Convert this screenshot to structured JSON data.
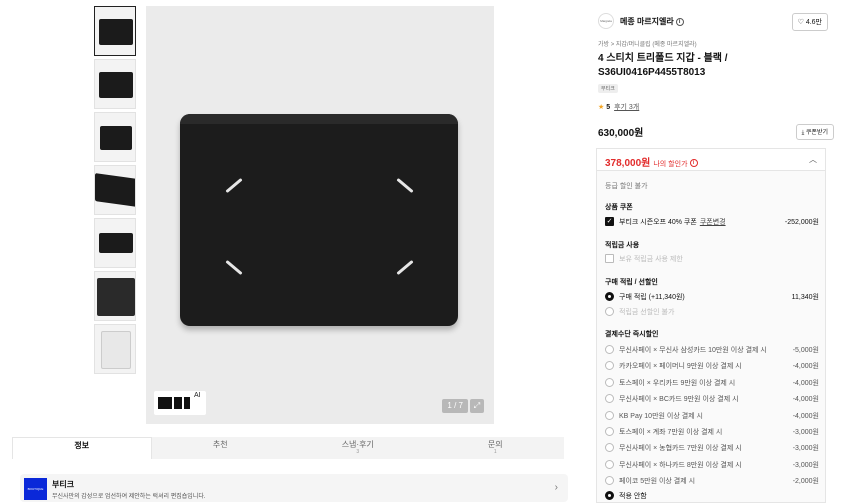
{
  "thumbnails": [
    "thumb-1",
    "thumb-2",
    "thumb-3",
    "thumb-4",
    "thumb-5",
    "thumb-6",
    "thumb-7"
  ],
  "image": {
    "ai_badge": "AI",
    "counter": "1 / 7"
  },
  "tabs": [
    {
      "label": "정보",
      "sub": ""
    },
    {
      "label": "추천",
      "sub": ""
    },
    {
      "label": "스냅·후기",
      "sub": "3"
    },
    {
      "label": "문의",
      "sub": "1"
    }
  ],
  "shop": {
    "logo_text": "BOUTIQUE",
    "name": "부티크",
    "desc": "무신사만의 감성으로 엄선하여 제안하는 럭셔리 편집숍입니다."
  },
  "product": {
    "brand": "메종 마르지엘라",
    "brand_logo_text": "Margiela",
    "likes": "4.6만",
    "breadcrumb": "가방 > 지갑/머니클립 (메종 마르지엘라)",
    "title": "4 스티치 트리폴드 지갑 - 블랙 / S36UI0416P4455T8013",
    "tag": "부티크",
    "rating": "5",
    "review_link": "후기 3개",
    "price": "630,000원",
    "coupon_button": "쿠폰받기"
  },
  "benefit": {
    "my_price": "378,000원",
    "my_price_label": "나의 할인가",
    "grade_text": "등급 할인 불가",
    "coupon_title": "상품 쿠폰",
    "coupon_label": "부티크 시즌오프 40% 쿠폰",
    "coupon_change": "쿠폰변경",
    "coupon_amount": "-252,000원",
    "points_title": "적립금 사용",
    "points_option": "보유 적립금 사용 제한",
    "purchase_title": "구매 적립 / 선할인",
    "purchase_option": "구매 적립 (+11,340원)",
    "purchase_amount": "11,340원",
    "prediscount_option": "적립금 선할인 불가",
    "payment_title": "결제수단 즉시할인",
    "payment_options": [
      {
        "label": "무신사페이 × 무신사 삼성카드 10만원 이상 결제 시",
        "amount": "-5,000원"
      },
      {
        "label": "카카오페이 × 페이머니 9만원 이상 결제 시",
        "amount": "-4,000원"
      },
      {
        "label": "토스페이 × 우리카드 9만원 이상 결제 시",
        "amount": "-4,000원"
      },
      {
        "label": "무신사페이 × BC카드 9만원 이상 결제 시",
        "amount": "-4,000원"
      },
      {
        "label": "KB Pay 10만원 이상 결제 시",
        "amount": "-4,000원"
      },
      {
        "label": "토스페이 × 계좌 7만원 이상 결제 시",
        "amount": "-3,000원"
      },
      {
        "label": "무신사페이 × 농협카드 7만원 이상 결제 시",
        "amount": "-3,000원"
      },
      {
        "label": "무신사페이 × 하나카드 8만원 이상 결제 시",
        "amount": "-3,000원"
      },
      {
        "label": "페이코 5만원 이상 결제 시",
        "amount": "-2,000원"
      }
    ],
    "no_apply": "적용 안함"
  }
}
